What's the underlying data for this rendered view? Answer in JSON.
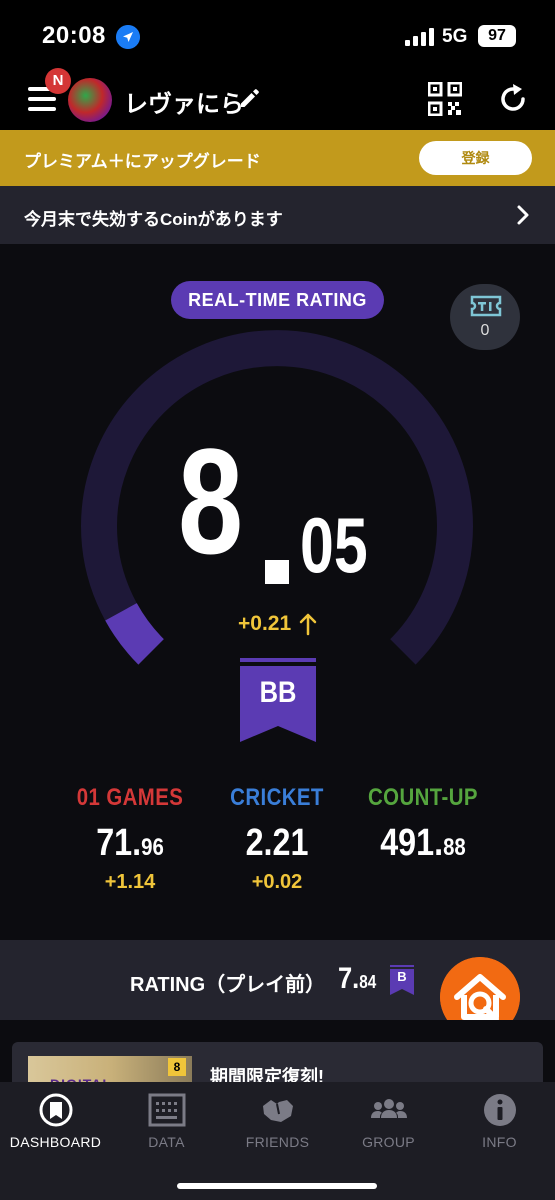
{
  "status_bar": {
    "time": "20:08",
    "network": "5G",
    "battery": "97"
  },
  "header": {
    "notification_badge": "N",
    "username": "レヴァにら"
  },
  "premium_banner": {
    "text": "プレミアム＋にアップグレード",
    "button": "登録"
  },
  "coin_notice": {
    "text": "今月末で失効するCoinがあります"
  },
  "rating": {
    "pill": "REAL-TIME RATING",
    "ticket_count": "0",
    "integer": "8",
    "decimal": "05",
    "delta": "+0.21",
    "rank": "BB",
    "gauge_fraction": 0.06,
    "colors": {
      "accent": "#5b3bb3",
      "track": "#1e1838",
      "delta": "#f0c53a"
    }
  },
  "stats": [
    {
      "title": "01 GAMES",
      "int": "71.",
      "dec": "96",
      "delta": "+1.14",
      "color": "#d43838"
    },
    {
      "title": "CRICKET",
      "int": "2.21",
      "dec": "",
      "delta": "+0.02",
      "color": "#3a7ed8"
    },
    {
      "title": "COUNT-UP",
      "int": "491.",
      "dec": "88",
      "delta": "",
      "color": "#55a53e"
    }
  ],
  "pre_play": {
    "label": "RATING（プレイ前）",
    "int": "7.",
    "dec": "84",
    "rank": "B"
  },
  "news": {
    "title": "期間限定復刻!",
    "thumb_text": "DIGITAL",
    "thumb_badge": "8"
  },
  "tabs": [
    {
      "label": "DASHBOARD",
      "icon": "dashboard-icon"
    },
    {
      "label": "DATA",
      "icon": "data-icon"
    },
    {
      "label": "FRIENDS",
      "icon": "friends-icon"
    },
    {
      "label": "GROUP",
      "icon": "group-icon"
    },
    {
      "label": "INFO",
      "icon": "info-icon"
    }
  ]
}
